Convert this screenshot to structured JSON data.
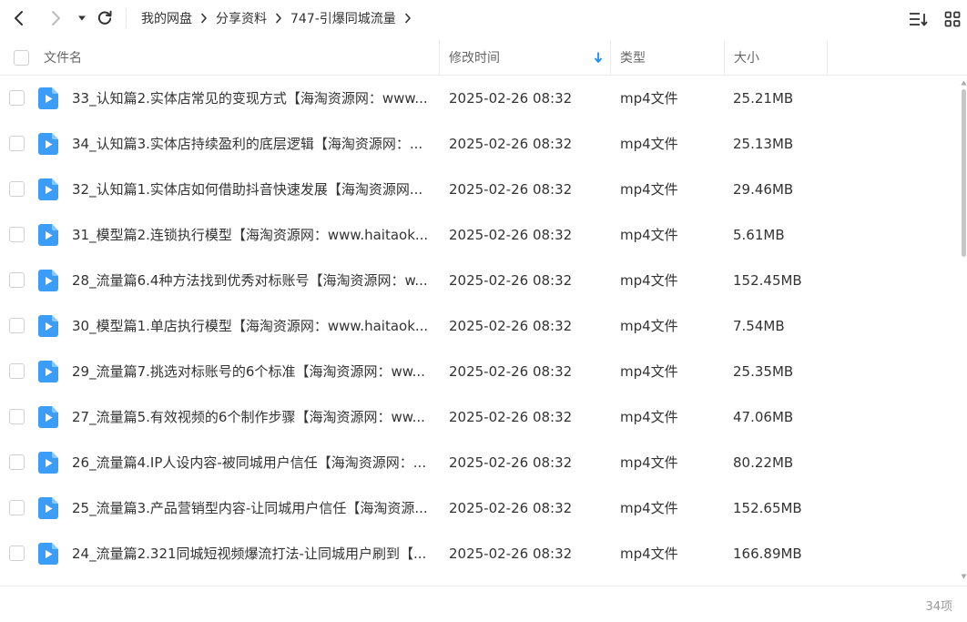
{
  "breadcrumb": [
    "我的网盘",
    "分享资料",
    "747-引爆同城流量"
  ],
  "columns": {
    "name": "文件名",
    "modified": "修改时间",
    "type": "类型",
    "size": "大小"
  },
  "colors": {
    "accent": "#1a8cff",
    "file_icon": "#3b9df8"
  },
  "icons": {
    "back": "chevron-left-icon",
    "forward": "chevron-right-icon",
    "history": "caret-down-icon",
    "refresh": "refresh-icon",
    "sort": "sort-list-icon",
    "grid": "grid-view-icon",
    "file": "video-file-icon"
  },
  "files": [
    {
      "name": "33_认知篇2.实体店常见的变现方式【海淘资源网：www....",
      "modified": "2025-02-26 08:32",
      "type": "mp4文件",
      "size": "25.21MB"
    },
    {
      "name": "34_认知篇3.实体店持续盈利的底层逻辑【海淘资源网：...",
      "modified": "2025-02-26 08:32",
      "type": "mp4文件",
      "size": "25.13MB"
    },
    {
      "name": "32_认知篇1.实体店如何借助抖音快速发展【海淘资源网...",
      "modified": "2025-02-26 08:32",
      "type": "mp4文件",
      "size": "29.46MB"
    },
    {
      "name": "31_模型篇2.连锁执行模型【海淘资源网：www.haitaok...",
      "modified": "2025-02-26 08:32",
      "type": "mp4文件",
      "size": "5.61MB"
    },
    {
      "name": "28_流量篇6.4种方法找到优秀对标账号【海淘资源网：w...",
      "modified": "2025-02-26 08:32",
      "type": "mp4文件",
      "size": "152.45MB"
    },
    {
      "name": "30_模型篇1.单店执行模型【海淘资源网：www.haitaok...",
      "modified": "2025-02-26 08:32",
      "type": "mp4文件",
      "size": "7.54MB"
    },
    {
      "name": "29_流量篇7.挑选对标账号的6个标准【海淘资源网：ww...",
      "modified": "2025-02-26 08:32",
      "type": "mp4文件",
      "size": "25.35MB"
    },
    {
      "name": "27_流量篇5.有效视频的6个制作步骤【海淘资源网：ww...",
      "modified": "2025-02-26 08:32",
      "type": "mp4文件",
      "size": "47.06MB"
    },
    {
      "name": "26_流量篇4.IP人设内容-被同城用户信任【海淘资源网：...",
      "modified": "2025-02-26 08:32",
      "type": "mp4文件",
      "size": "80.22MB"
    },
    {
      "name": "25_流量篇3.产品营销型内容-让同城用户信任【海淘资源...",
      "modified": "2025-02-26 08:32",
      "type": "mp4文件",
      "size": "152.65MB"
    },
    {
      "name": "24_流量篇2.321同城短视频爆流打法-让同城用户刷到【...",
      "modified": "2025-02-26 08:32",
      "type": "mp4文件",
      "size": "166.89MB"
    }
  ],
  "footer": {
    "count": "34项"
  }
}
